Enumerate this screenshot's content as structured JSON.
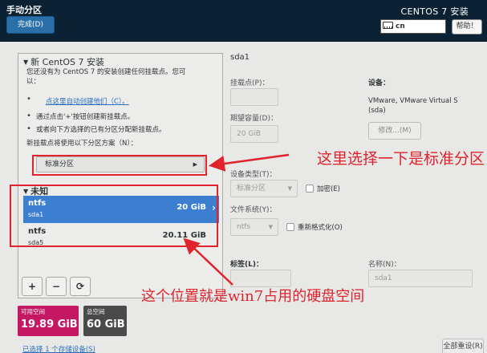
{
  "header": {
    "page_title": "手动分区",
    "done_button": "完成(D)",
    "install_title": "CENTOS 7 安装",
    "keyboard_layout": "cn",
    "help_button": "帮助！"
  },
  "left": {
    "new_install_title": "新 CentOS 7 安装",
    "no_mount_msg_1": "您还没有为 CentOS 7 的安装创建任何挂载点。您可",
    "no_mount_msg_2": "以：",
    "auto_create_link": "点这里自动创建他们（C）。",
    "hint_add": "通过点击'+'按钮创建新挂载点。",
    "hint_assign": "或者向下方选择的已有分区分配新挂载点。",
    "scheme_label": "新挂载点将使用以下分区方案（N）：",
    "scheme_value": "标准分区",
    "unknown_title": "未知",
    "partitions": [
      {
        "fs": "ntfs",
        "device": "sda1",
        "size": "20 GiB",
        "selected": true
      },
      {
        "fs": "ntfs",
        "device": "sda5",
        "size": "20.11 GiB",
        "selected": false
      }
    ],
    "buttons": {
      "add": "+",
      "remove": "−",
      "refresh": "⟳"
    }
  },
  "space": {
    "available_label": "可用空间",
    "available_value": "19.89 GiB",
    "total_label": "总空间",
    "total_value": "60 GiB",
    "storage_link": "已选择 1 个存储设备(S)"
  },
  "right": {
    "disk_title": "sda1",
    "mount_point_label": "挂载点(P)：",
    "mount_point_value": "",
    "capacity_label": "期望容量(D)：",
    "capacity_value": "20 GiB",
    "device_label": "设备：",
    "device_text_1": "VMware, VMware Virtual S",
    "device_text_2": "(sda)",
    "modify_button": "修改...(M)",
    "device_type_label": "设备类型(T)：",
    "device_type_value": "标准分区",
    "encrypt_label": "加密(E)",
    "filesystem_label": "文件系统(Y)：",
    "filesystem_value": "ntfs",
    "reformat_label": "重新格式化(O)",
    "tag_label": "标签(L)：",
    "tag_value": "",
    "name_label": "名称(N)：",
    "name_value": "sda1",
    "reset_button": "全部重设(R)"
  },
  "annotations": {
    "note_1": "这里选择一下是标准分区",
    "note_2": "这个位置就是win7占用的硬盘空间"
  },
  "colors": {
    "topbar": "#0a2233",
    "selection": "#3c7fd0",
    "available": "#c51862",
    "total": "#4a4a4a",
    "annotation": "#e0232d",
    "link": "#2a6fbf"
  }
}
